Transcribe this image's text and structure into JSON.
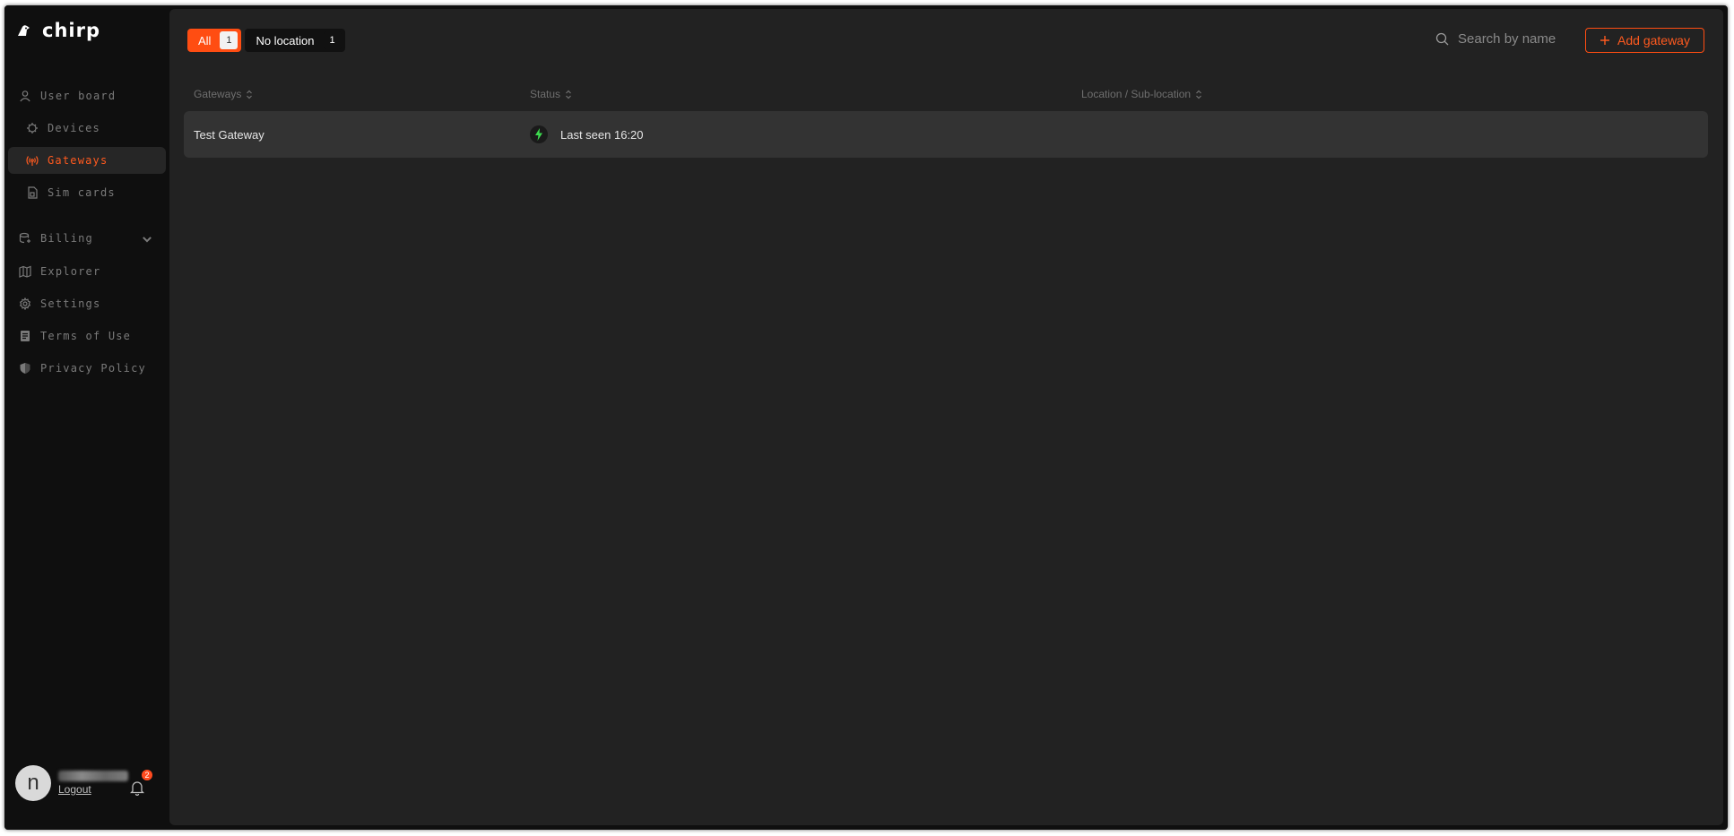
{
  "brand": {
    "name": "chirp"
  },
  "sidebar": {
    "items": [
      {
        "label": "User board",
        "icon": "user-icon"
      },
      {
        "label": "Devices",
        "icon": "chip-icon"
      },
      {
        "label": "Gateways",
        "icon": "antenna-icon",
        "active": true
      },
      {
        "label": "Sim cards",
        "icon": "sim-icon"
      },
      {
        "label": "Billing",
        "icon": "billing-icon"
      },
      {
        "label": "Explorer",
        "icon": "map-icon"
      },
      {
        "label": "Settings",
        "icon": "gear-icon"
      },
      {
        "label": "Terms of Use",
        "icon": "document-icon"
      },
      {
        "label": "Privacy Policy",
        "icon": "shield-icon"
      }
    ]
  },
  "user": {
    "initial": "n",
    "logout_label": "Logout",
    "notification_count": "2"
  },
  "filters": [
    {
      "label": "All",
      "count": "1",
      "active": true
    },
    {
      "label": "No location",
      "count": "1",
      "active": false
    }
  ],
  "search": {
    "placeholder": "Search by name"
  },
  "add_button": {
    "label": "Add gateway"
  },
  "table": {
    "columns": [
      "Gateways",
      "Status",
      "Location / Sub-location"
    ],
    "rows": [
      {
        "name": "Test Gateway",
        "status": "Last seen 16:20",
        "location": ""
      }
    ]
  },
  "colors": {
    "accent": "#ff4d12",
    "status_online": "#3ddc4f",
    "panel": "#222222",
    "sidebar": "#0f0f0f"
  }
}
